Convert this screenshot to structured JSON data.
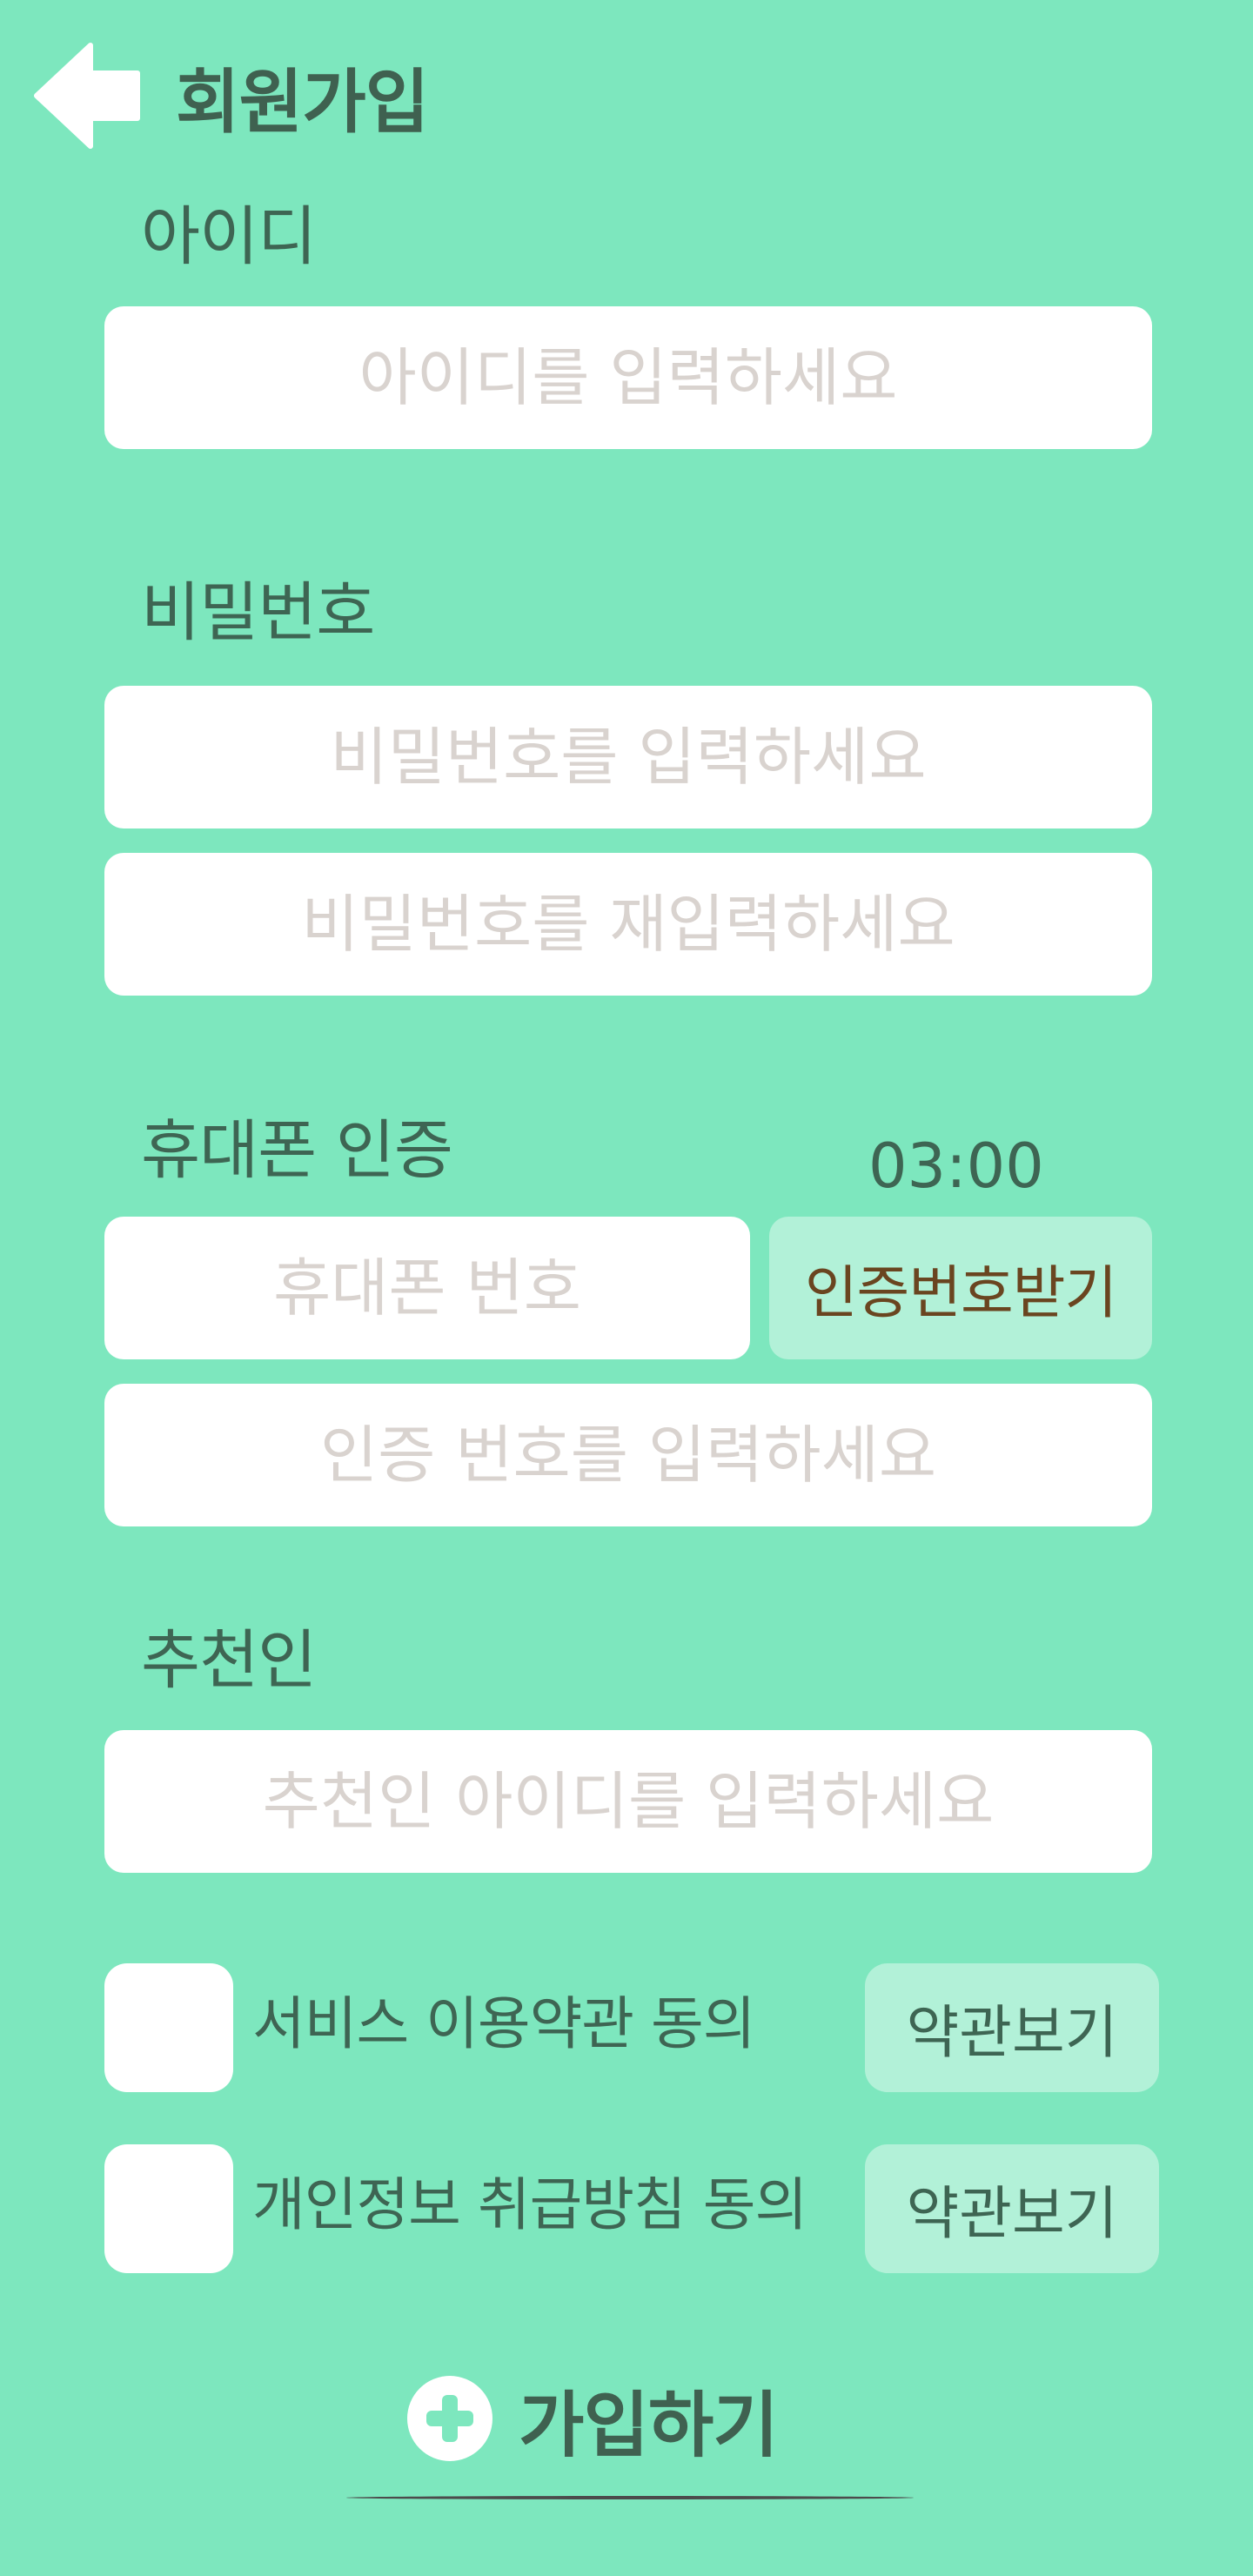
{
  "header": {
    "title": "회원가입"
  },
  "id_section": {
    "label": "아이디",
    "placeholder": "아이디를 입력하세요"
  },
  "password_section": {
    "label": "비밀번호",
    "placeholder": "비밀번호를 입력하세요",
    "confirm_placeholder": "비밀번호를 재입력하세요"
  },
  "phone_section": {
    "label": "휴대폰 인증",
    "timer": "03:00",
    "phone_placeholder": "휴대폰 번호",
    "request_button": "인증번호받기",
    "code_placeholder": "인증 번호를 입력하세요"
  },
  "referrer_section": {
    "label": "추천인",
    "placeholder": "추천인 아이디를 입력하세요"
  },
  "agreements": [
    {
      "label": "서비스 이용약관 동의",
      "button": "약관보기"
    },
    {
      "label": "개인정보 취급방침 동의",
      "button": "약관보기"
    }
  ],
  "submit": {
    "label": "가입하기"
  },
  "colors": {
    "background": "#7de7be",
    "field": "#ffffff",
    "secondary_button": "#b2f1d8",
    "text": "#3e6553",
    "placeholder": "#d9d3cf"
  }
}
